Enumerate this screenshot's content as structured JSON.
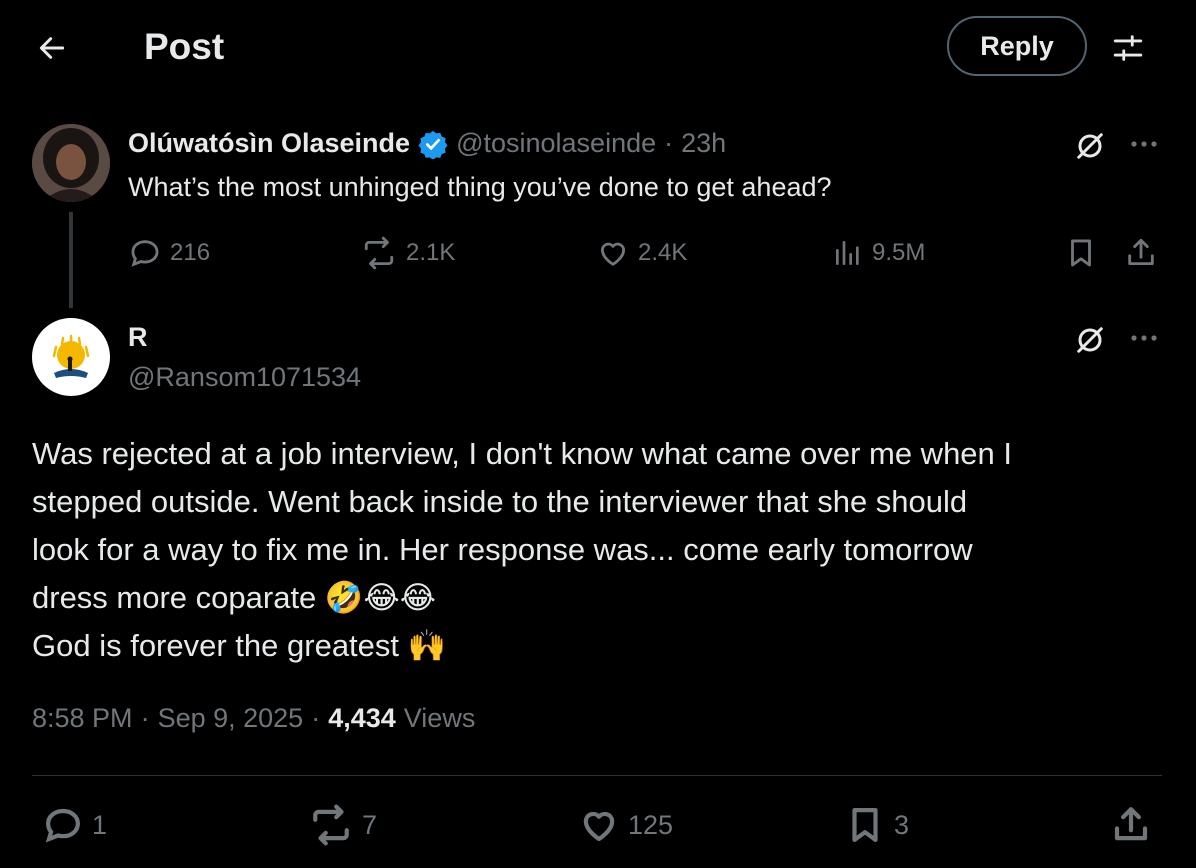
{
  "header": {
    "title": "Post",
    "reply_label": "Reply",
    "back_icon": "arrow-left-icon",
    "settings_icon": "sliders-icon"
  },
  "parent_post": {
    "display_name": "Olúwatósìn Olaseinde",
    "verified": true,
    "handle": "@tosinolaseinde",
    "separator": "·",
    "time": "23h",
    "text": "What’s the most unhinged thing you’ve done to get ahead?",
    "replies": "216",
    "reposts": "2.1K",
    "likes": "2.4K",
    "views": "9.5M"
  },
  "main_post": {
    "display_name": "R",
    "handle": "@Ransom1071534",
    "text_lines": [
      "Was rejected at a job interview, I don't know what came over me when I",
      "stepped outside. Went back inside to the interviewer that she should",
      "look for a way to fix me in. Her response was... come early tomorrow",
      "dress more coparate 🤣😂😂",
      "God is forever the greatest 🙌"
    ],
    "time": "8:58 PM",
    "date": "Sep 9, 2025",
    "separator": "·",
    "views_count": "4,434",
    "views_label": "Views",
    "replies": "1",
    "reposts": "7",
    "likes": "125",
    "bookmarks": "3"
  },
  "colors": {
    "background": "#000000",
    "text": "#e7e9ea",
    "muted": "#71767b",
    "verified": "#1d9bf0",
    "divider": "#2f3336"
  }
}
